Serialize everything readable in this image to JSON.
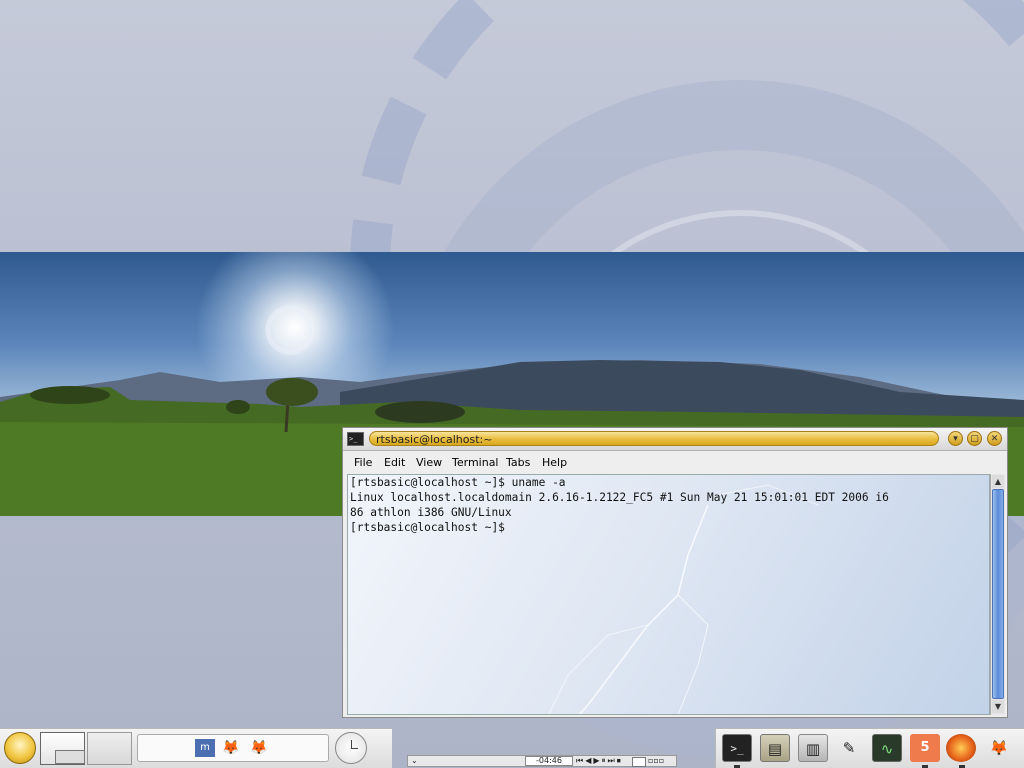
{
  "terminal": {
    "title": "rtsbasic@localhost:~",
    "icon": "terminal-icon",
    "buttons": [
      "minimize-icon",
      "maximize-icon",
      "close-icon"
    ],
    "menu": [
      "File",
      "Edit",
      "View",
      "Terminal",
      "Tabs",
      "Help"
    ],
    "lines": [
      "[rtsbasic@localhost ~]$ uname -a",
      "Linux localhost.localdomain 2.6.16-1.2122_FC5 #1 Sun May 21 15:01:01 EDT 2006 i6",
      "86 athlon i386 GNU/Linux",
      "[rtsbasic@localhost ~]$"
    ]
  },
  "taskbar": {
    "kmenu_icon": "k-menu-icon",
    "tasklist_icons": [
      "m-app-icon",
      "gimp-icon",
      "gimp-icon"
    ],
    "clock_icon": "clock-icon"
  },
  "media_player": {
    "time": "-04:46"
  },
  "tray": {
    "icons": [
      "terminal-icon",
      "file-cabinet-icon",
      "disk-drive-icon",
      "text-editor-icon",
      "system-monitor-icon",
      "app-5-icon",
      "firefox-icon",
      "gimp-icon"
    ]
  },
  "colors": {
    "title_accent": "#e8bd3f",
    "scroll_accent": "#5b8bd8"
  }
}
